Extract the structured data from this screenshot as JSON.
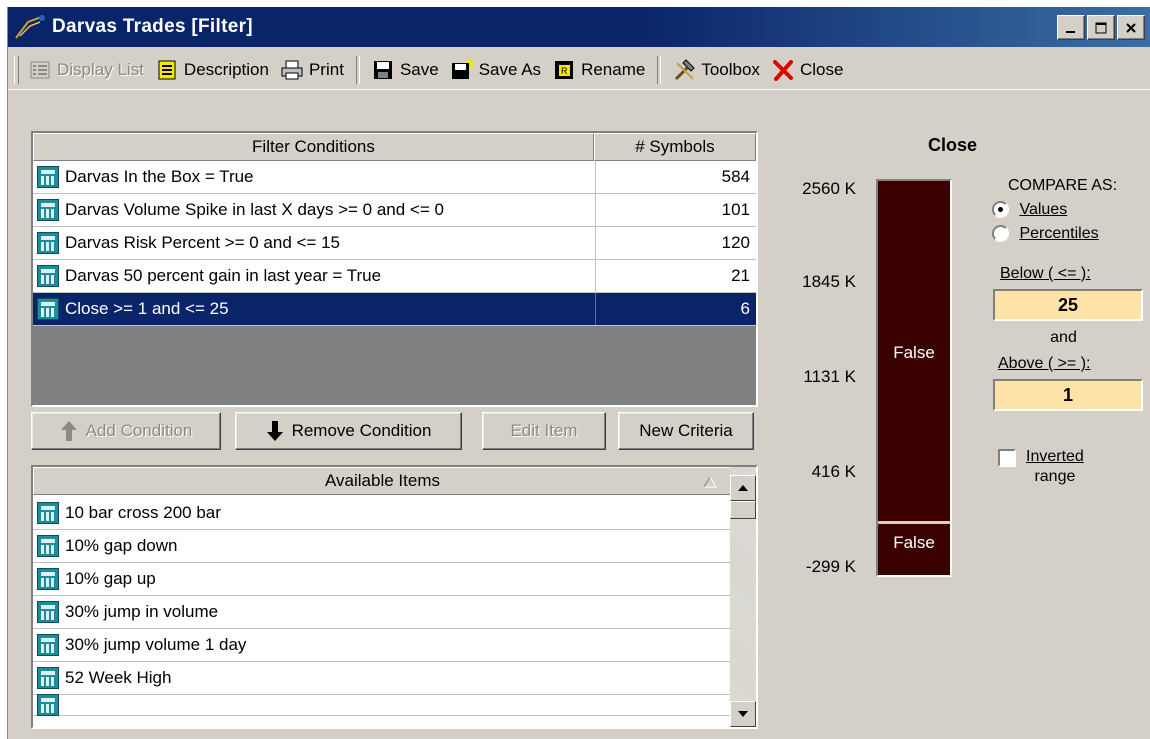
{
  "window": {
    "title": "Darvas Trades  [Filter]"
  },
  "toolbar": {
    "display_list": "Display List",
    "description": "Description",
    "print": "Print",
    "save": "Save",
    "save_as": "Save As",
    "rename": "Rename",
    "toolbox": "Toolbox",
    "close": "Close"
  },
  "conditions": {
    "headers": [
      "Filter Conditions",
      "# Symbols"
    ],
    "rows": [
      {
        "label": "Darvas In the Box  = True",
        "count": "584"
      },
      {
        "label": "Darvas Volume Spike in last X days  >= 0 and  <= 0",
        "count": "101"
      },
      {
        "label": "Darvas Risk Percent  >= 0 and  <= 15",
        "count": "120"
      },
      {
        "label": "Darvas 50 percent gain in last year  = True",
        "count": "21"
      },
      {
        "label": "Close  >= 1 and  <= 25",
        "count": "6"
      }
    ]
  },
  "buttons": {
    "add": "Add Condition",
    "remove": "Remove Condition",
    "edit": "Edit Item",
    "new": "New Criteria"
  },
  "available": {
    "header": "Available Items",
    "items": [
      "10 bar cross 200 bar",
      "10% gap down",
      "10% gap up",
      "30% jump in volume",
      "30% jump volume 1 day",
      "52 Week High"
    ]
  },
  "chart": {
    "title": "Close",
    "yticks": [
      "2560 K",
      "1845 K",
      "1131 K",
      "416 K",
      "-299 K"
    ],
    "bar_upper_label": "False",
    "bar_lower_label": "False",
    "bar_color": "#3a0000"
  },
  "compare": {
    "heading": "COMPARE AS:",
    "opt_values": "Values",
    "opt_percentiles": "Percentiles",
    "below_label": "Below ( <= ):",
    "below_value": "25",
    "and_label": "and",
    "above_label": "Above ( >= ):",
    "above_value": "1",
    "inverted_label_1": "Inverted",
    "inverted_label_2": "range"
  }
}
